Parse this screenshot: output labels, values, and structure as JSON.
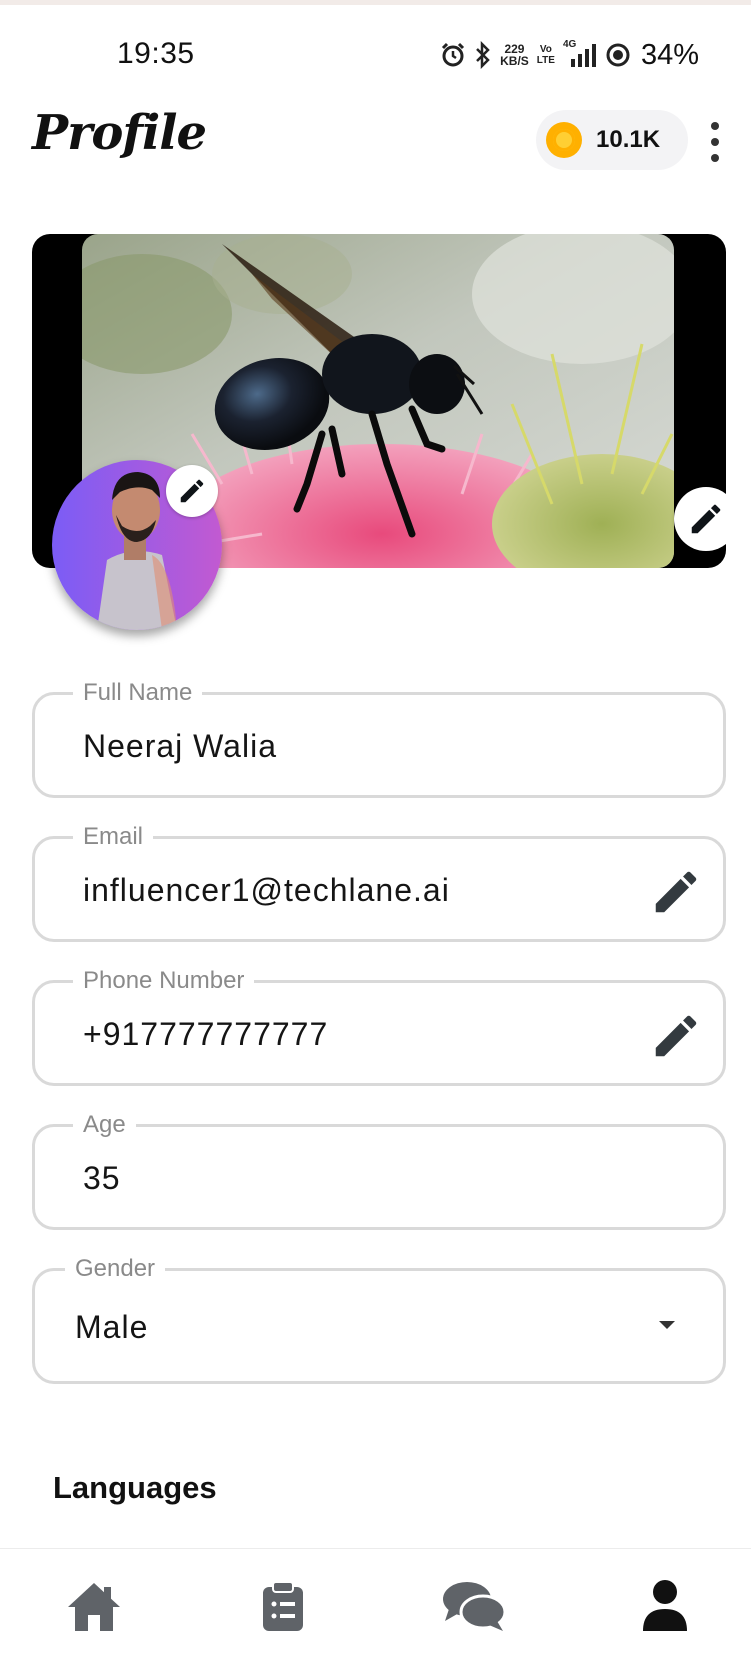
{
  "status_bar": {
    "time": "19:35",
    "net_speed_value": "229",
    "net_speed_unit": "KB/S",
    "volte_top": "Vo",
    "volte_bottom": "LTE",
    "network_type": "4G",
    "battery": "34%",
    "icons": [
      "alarm-icon",
      "bluetooth-icon",
      "signal-icon",
      "battery-saver-icon"
    ]
  },
  "header": {
    "title": "Profile",
    "coins": "10.1K",
    "coin_color": "#FFB000"
  },
  "cover": {
    "image_description_icon": "bee-on-flower-image",
    "edit_icon": "pencil-icon"
  },
  "avatar": {
    "edit_icon": "pencil-icon",
    "gradient": [
      "#8a5cf6",
      "#c058c8"
    ]
  },
  "form": {
    "full_name": {
      "label": "Full Name",
      "value": "Neeraj Walia"
    },
    "email": {
      "label": "Email",
      "value": "influencer1@techlane.ai"
    },
    "phone": {
      "label": "Phone Number",
      "value": "+917777777777"
    },
    "age": {
      "label": "Age",
      "value": "35"
    },
    "gender": {
      "label": "Gender",
      "value": "Male"
    }
  },
  "languages": {
    "title": "Languages"
  },
  "bottom_nav": {
    "items": [
      "home-icon",
      "tasks-icon",
      "chat-icon",
      "profile-icon"
    ],
    "active_color": "#111111",
    "inactive_color": "#5f6368"
  }
}
